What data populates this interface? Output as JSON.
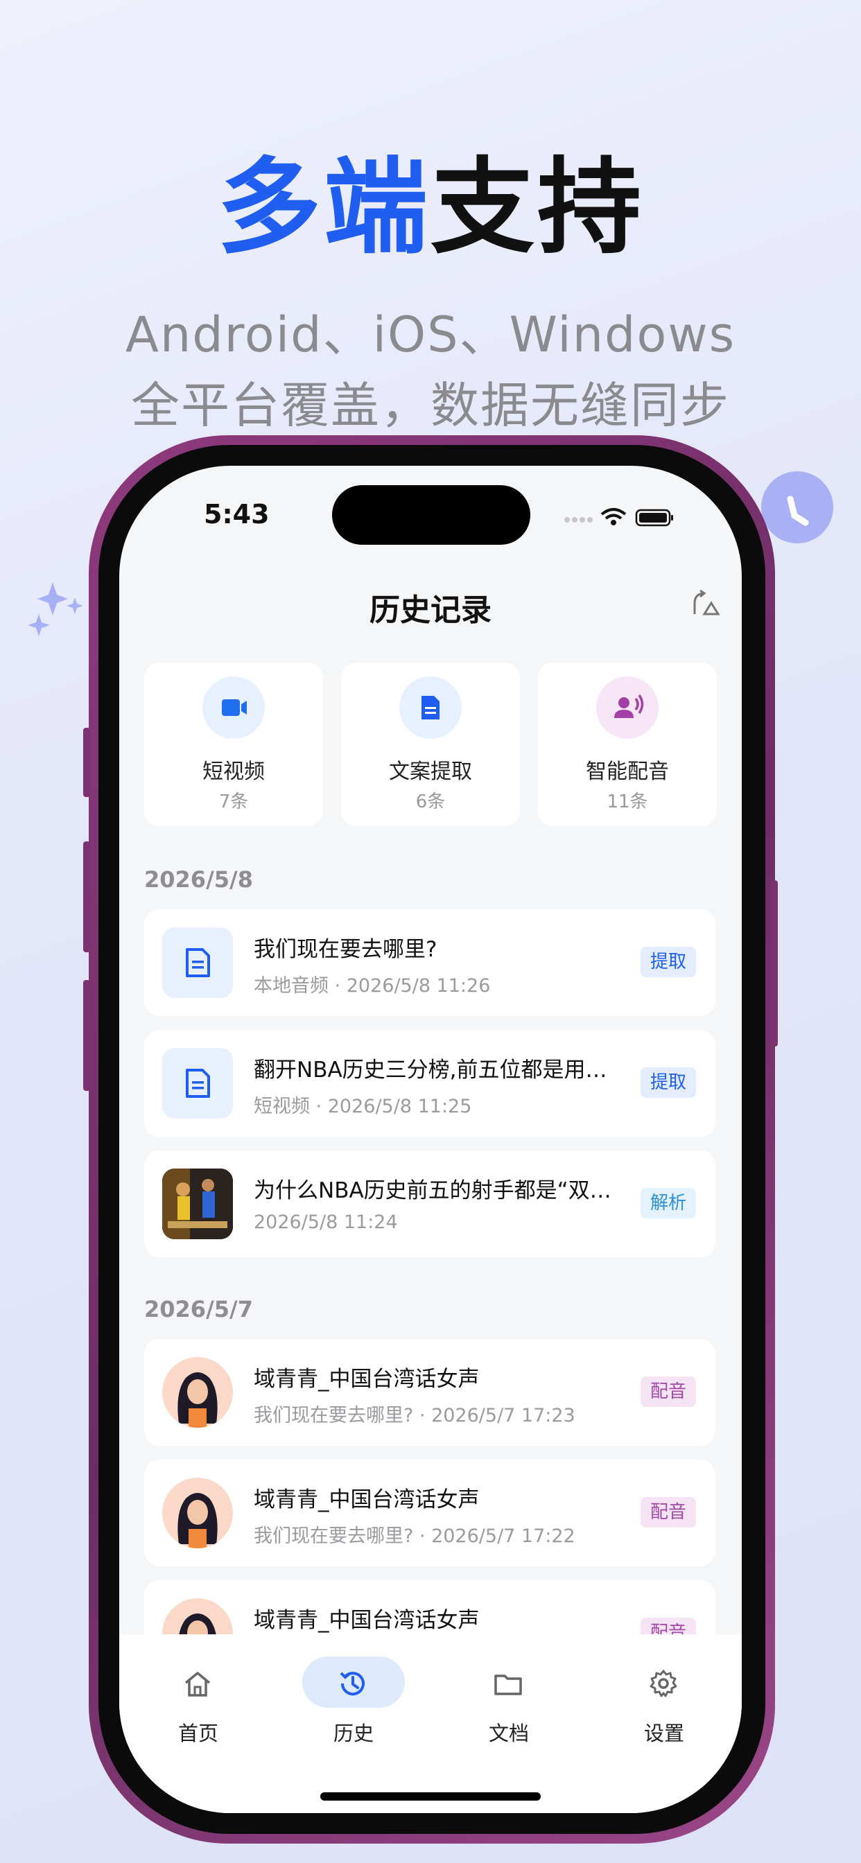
{
  "hero": {
    "title_blue": "多端",
    "title_dark": "支持",
    "subtitle_line1": "Android、iOS、Windows",
    "subtitle_line2": "全平台覆盖，数据无缝同步"
  },
  "status_bar": {
    "time": "5:43"
  },
  "header": {
    "title": "历史记录"
  },
  "categories": [
    {
      "label": "短视频",
      "count": "7条",
      "icon": "video-camera-icon"
    },
    {
      "label": "文案提取",
      "count": "6条",
      "icon": "document-icon"
    },
    {
      "label": "智能配音",
      "count": "11条",
      "icon": "voice-user-icon"
    }
  ],
  "groups": [
    {
      "date": "2026/5/8",
      "items": [
        {
          "title": "我们现在要去哪里?",
          "meta": "本地音频 · 2026/5/8 11:26",
          "badge": "提取",
          "thumb": "document-icon"
        },
        {
          "title": "翻开NBA历史三分榜,前五位都是用…",
          "meta": "短视频 · 2026/5/8 11:25",
          "badge": "提取",
          "thumb": "document-icon"
        },
        {
          "title": "为什么NBA历史前五的射手都是“双…",
          "meta": "2026/5/8 11:24",
          "badge": "解析",
          "thumb": "video-cover-image"
        }
      ]
    },
    {
      "date": "2026/5/7",
      "items": [
        {
          "title": "域青青_中国台湾话女声",
          "meta": "我们现在要去哪里? · 2026/5/7 17:23",
          "badge": "配音",
          "thumb": "avatar-woman"
        },
        {
          "title": "域青青_中国台湾话女声",
          "meta": "我们现在要去哪里? · 2026/5/7 17:22",
          "badge": "配音",
          "thumb": "avatar-woman"
        },
        {
          "title": "域青青_中国台湾话女声",
          "meta": "",
          "badge": "配音",
          "thumb": "avatar-woman"
        }
      ]
    }
  ],
  "tabs": [
    {
      "label": "首页",
      "icon": "home-icon"
    },
    {
      "label": "历史",
      "icon": "history-icon",
      "active": true
    },
    {
      "label": "文档",
      "icon": "folder-icon"
    },
    {
      "label": "设置",
      "icon": "gear-icon"
    }
  ],
  "colors": {
    "accent": "#1f5ef0",
    "badge_extract_bg": "#e4edff",
    "badge_parse_bg": "#e3f2fd",
    "badge_dub_bg": "#f4e4f4",
    "badge_dub_text": "#a34aa8"
  }
}
